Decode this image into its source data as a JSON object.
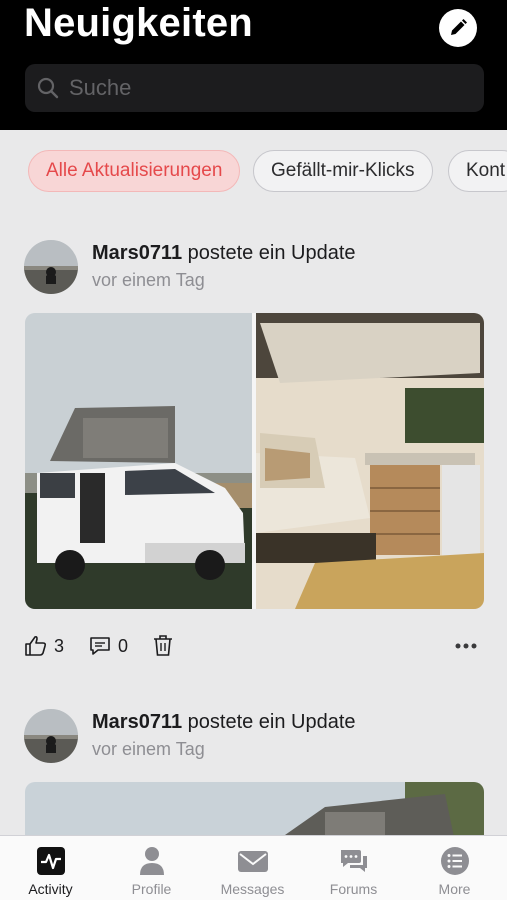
{
  "header": {
    "title": "Neuigkeiten",
    "search_placeholder": "Suche"
  },
  "filters": [
    {
      "label": "Alle Aktualisierungen",
      "active": true
    },
    {
      "label": "Gefällt-mir-Klicks",
      "active": false
    },
    {
      "label": "Kont",
      "active": false
    }
  ],
  "posts": [
    {
      "author": "Mars0711",
      "action": "postete ein Update",
      "time": "vor einem Tag",
      "likes": "3",
      "comments": "0"
    },
    {
      "author": "Mars0711",
      "action": "postete ein Update",
      "time": "vor einem Tag"
    }
  ],
  "tabs": [
    {
      "label": "Activity",
      "icon": "activity-icon",
      "active": true
    },
    {
      "label": "Profile",
      "icon": "profile-icon"
    },
    {
      "label": "Messages",
      "icon": "envelope-icon"
    },
    {
      "label": "Forums",
      "icon": "chat-bubbles-icon"
    },
    {
      "label": "More",
      "icon": "list-icon"
    }
  ],
  "colors": {
    "accent": "#e5494b",
    "header_bg": "#000000",
    "page_bg": "#e9e9ea"
  }
}
